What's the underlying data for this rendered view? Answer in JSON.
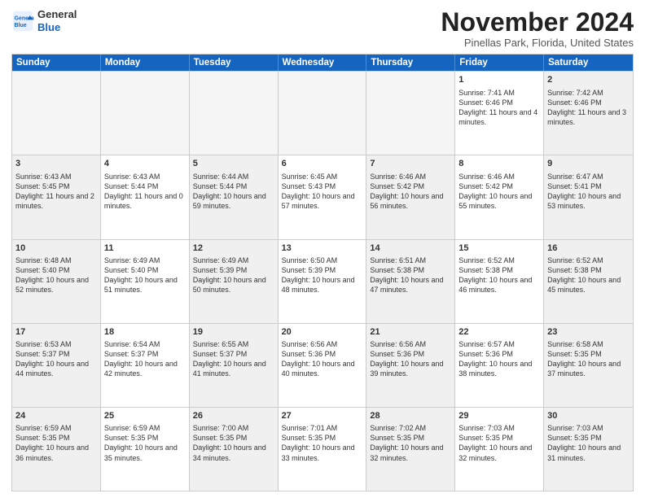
{
  "header": {
    "logo_line1": "General",
    "logo_line2": "Blue",
    "month_title": "November 2024",
    "location": "Pinellas Park, Florida, United States"
  },
  "days_of_week": [
    "Sunday",
    "Monday",
    "Tuesday",
    "Wednesday",
    "Thursday",
    "Friday",
    "Saturday"
  ],
  "rows": [
    [
      {
        "day": "",
        "text": "",
        "empty": true
      },
      {
        "day": "",
        "text": "",
        "empty": true
      },
      {
        "day": "",
        "text": "",
        "empty": true
      },
      {
        "day": "",
        "text": "",
        "empty": true
      },
      {
        "day": "",
        "text": "",
        "empty": true
      },
      {
        "day": "1",
        "text": "Sunrise: 7:41 AM\nSunset: 6:46 PM\nDaylight: 11 hours and 4 minutes.",
        "empty": false
      },
      {
        "day": "2",
        "text": "Sunrise: 7:42 AM\nSunset: 6:46 PM\nDaylight: 11 hours and 3 minutes.",
        "empty": false,
        "shaded": true
      }
    ],
    [
      {
        "day": "3",
        "text": "Sunrise: 6:43 AM\nSunset: 5:45 PM\nDaylight: 11 hours and 2 minutes.",
        "empty": false,
        "shaded": true
      },
      {
        "day": "4",
        "text": "Sunrise: 6:43 AM\nSunset: 5:44 PM\nDaylight: 11 hours and 0 minutes.",
        "empty": false
      },
      {
        "day": "5",
        "text": "Sunrise: 6:44 AM\nSunset: 5:44 PM\nDaylight: 10 hours and 59 minutes.",
        "empty": false,
        "shaded": true
      },
      {
        "day": "6",
        "text": "Sunrise: 6:45 AM\nSunset: 5:43 PM\nDaylight: 10 hours and 57 minutes.",
        "empty": false
      },
      {
        "day": "7",
        "text": "Sunrise: 6:46 AM\nSunset: 5:42 PM\nDaylight: 10 hours and 56 minutes.",
        "empty": false,
        "shaded": true
      },
      {
        "day": "8",
        "text": "Sunrise: 6:46 AM\nSunset: 5:42 PM\nDaylight: 10 hours and 55 minutes.",
        "empty": false
      },
      {
        "day": "9",
        "text": "Sunrise: 6:47 AM\nSunset: 5:41 PM\nDaylight: 10 hours and 53 minutes.",
        "empty": false,
        "shaded": true
      }
    ],
    [
      {
        "day": "10",
        "text": "Sunrise: 6:48 AM\nSunset: 5:40 PM\nDaylight: 10 hours and 52 minutes.",
        "empty": false,
        "shaded": true
      },
      {
        "day": "11",
        "text": "Sunrise: 6:49 AM\nSunset: 5:40 PM\nDaylight: 10 hours and 51 minutes.",
        "empty": false
      },
      {
        "day": "12",
        "text": "Sunrise: 6:49 AM\nSunset: 5:39 PM\nDaylight: 10 hours and 50 minutes.",
        "empty": false,
        "shaded": true
      },
      {
        "day": "13",
        "text": "Sunrise: 6:50 AM\nSunset: 5:39 PM\nDaylight: 10 hours and 48 minutes.",
        "empty": false
      },
      {
        "day": "14",
        "text": "Sunrise: 6:51 AM\nSunset: 5:38 PM\nDaylight: 10 hours and 47 minutes.",
        "empty": false,
        "shaded": true
      },
      {
        "day": "15",
        "text": "Sunrise: 6:52 AM\nSunset: 5:38 PM\nDaylight: 10 hours and 46 minutes.",
        "empty": false
      },
      {
        "day": "16",
        "text": "Sunrise: 6:52 AM\nSunset: 5:38 PM\nDaylight: 10 hours and 45 minutes.",
        "empty": false,
        "shaded": true
      }
    ],
    [
      {
        "day": "17",
        "text": "Sunrise: 6:53 AM\nSunset: 5:37 PM\nDaylight: 10 hours and 44 minutes.",
        "empty": false,
        "shaded": true
      },
      {
        "day": "18",
        "text": "Sunrise: 6:54 AM\nSunset: 5:37 PM\nDaylight: 10 hours and 42 minutes.",
        "empty": false
      },
      {
        "day": "19",
        "text": "Sunrise: 6:55 AM\nSunset: 5:37 PM\nDaylight: 10 hours and 41 minutes.",
        "empty": false,
        "shaded": true
      },
      {
        "day": "20",
        "text": "Sunrise: 6:56 AM\nSunset: 5:36 PM\nDaylight: 10 hours and 40 minutes.",
        "empty": false
      },
      {
        "day": "21",
        "text": "Sunrise: 6:56 AM\nSunset: 5:36 PM\nDaylight: 10 hours and 39 minutes.",
        "empty": false,
        "shaded": true
      },
      {
        "day": "22",
        "text": "Sunrise: 6:57 AM\nSunset: 5:36 PM\nDaylight: 10 hours and 38 minutes.",
        "empty": false
      },
      {
        "day": "23",
        "text": "Sunrise: 6:58 AM\nSunset: 5:35 PM\nDaylight: 10 hours and 37 minutes.",
        "empty": false,
        "shaded": true
      }
    ],
    [
      {
        "day": "24",
        "text": "Sunrise: 6:59 AM\nSunset: 5:35 PM\nDaylight: 10 hours and 36 minutes.",
        "empty": false,
        "shaded": true
      },
      {
        "day": "25",
        "text": "Sunrise: 6:59 AM\nSunset: 5:35 PM\nDaylight: 10 hours and 35 minutes.",
        "empty": false
      },
      {
        "day": "26",
        "text": "Sunrise: 7:00 AM\nSunset: 5:35 PM\nDaylight: 10 hours and 34 minutes.",
        "empty": false,
        "shaded": true
      },
      {
        "day": "27",
        "text": "Sunrise: 7:01 AM\nSunset: 5:35 PM\nDaylight: 10 hours and 33 minutes.",
        "empty": false
      },
      {
        "day": "28",
        "text": "Sunrise: 7:02 AM\nSunset: 5:35 PM\nDaylight: 10 hours and 32 minutes.",
        "empty": false,
        "shaded": true
      },
      {
        "day": "29",
        "text": "Sunrise: 7:03 AM\nSunset: 5:35 PM\nDaylight: 10 hours and 32 minutes.",
        "empty": false
      },
      {
        "day": "30",
        "text": "Sunrise: 7:03 AM\nSunset: 5:35 PM\nDaylight: 10 hours and 31 minutes.",
        "empty": false,
        "shaded": true
      }
    ]
  ]
}
